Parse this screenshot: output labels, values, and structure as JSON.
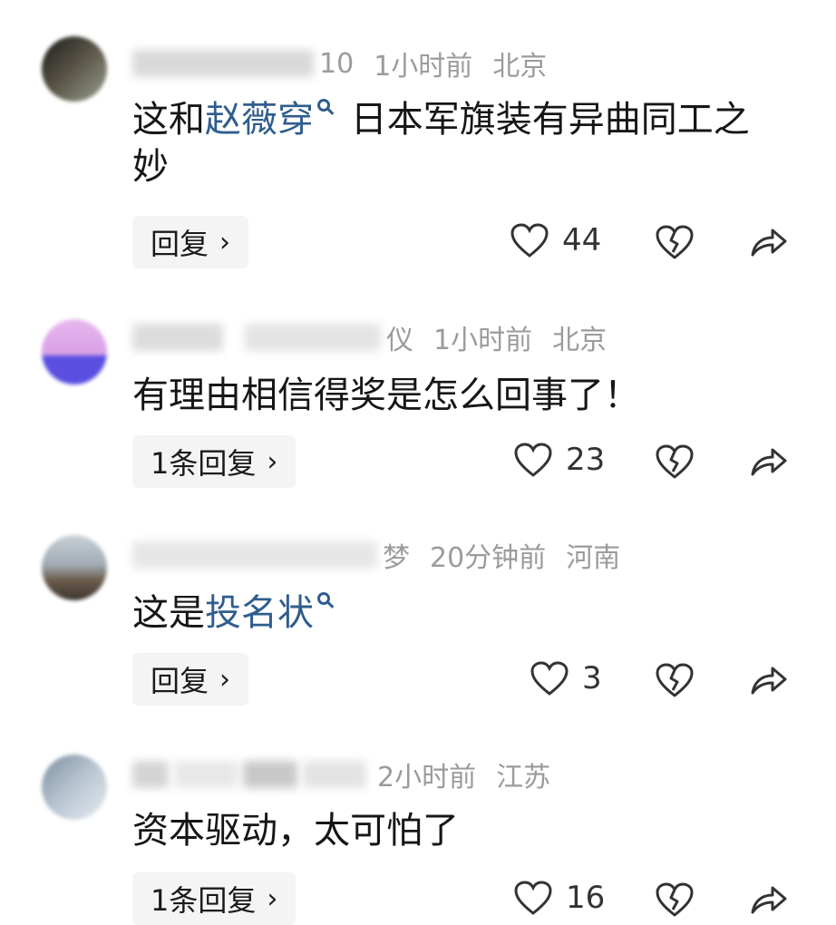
{
  "comments": [
    {
      "name_visible": "10",
      "time": "1小时前",
      "location": "北京",
      "text_parts": [
        "这和",
        "赵薇穿",
        " 日本军旗装有异曲同工之妙"
      ],
      "reply_label": "回复",
      "likes": "44"
    },
    {
      "name_visible": "仪",
      "time": "1小时前",
      "location": "北京",
      "text": "有理由相信得奖是怎么回事了！",
      "reply_label": "1条回复",
      "likes": "23"
    },
    {
      "name_visible": "梦",
      "time": "20分钟前",
      "location": "河南",
      "text_parts": [
        "这是",
        "投名状"
      ],
      "reply_label": "回复",
      "likes": "3"
    },
    {
      "name_visible": "",
      "time": "2小时前",
      "location": "江苏",
      "text": "资本驱动，太可怕了",
      "reply_label": "1条回复",
      "likes": "16"
    }
  ],
  "icons": {
    "like": "heart-outline-icon",
    "dislike": "broken-heart-icon",
    "share": "share-arrow-icon",
    "search": "search-icon",
    "chevron": "chevron-right-icon"
  }
}
